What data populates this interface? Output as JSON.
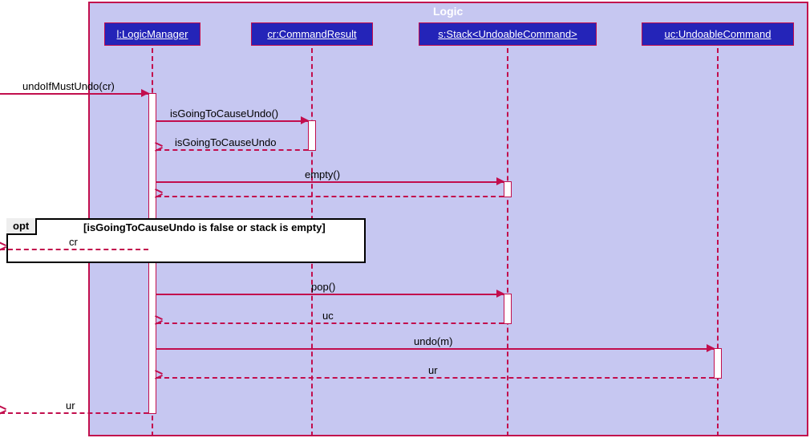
{
  "frame": {
    "title": "Logic"
  },
  "lifelines": {
    "logicManager": "l:LogicManager",
    "commandResult": "cr:CommandResult",
    "stack": "s:Stack<UndoableCommand>",
    "undoableCommand": "uc:UndoableCommand"
  },
  "messages": {
    "m1": "undoIfMustUndo(cr)",
    "m2": "isGoingToCauseUndo()",
    "m3": "isGoingToCauseUndo",
    "m4": "empty()",
    "m5_return": "",
    "m6": "cr",
    "m7": "pop()",
    "m8": "uc",
    "m9": "undo(m)",
    "m10": "ur",
    "m11": "ur"
  },
  "opt": {
    "label": "opt",
    "guard": "[isGoingToCauseUndo is false or stack is empty]"
  }
}
